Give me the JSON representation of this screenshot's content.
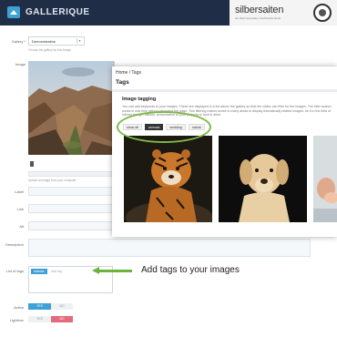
{
  "app": {
    "title": "GALLERIQUE",
    "brand": "silbersaiten",
    "brand_tagline": "die Raumausstatter-Fachhändlerkette"
  },
  "form": {
    "gallery_label": "Gallery",
    "gallery_value": "Demonstration",
    "gallery_hint": "Choose the gallery for this image",
    "image_label": "Image",
    "upload_hint": "Upload an image from your computer",
    "fields": [
      {
        "label": "Label"
      },
      {
        "label": "Link"
      },
      {
        "label": "Alt"
      },
      {
        "label": "Description"
      }
    ],
    "tags_label": "List of tags",
    "tag_chip": "animals",
    "tag_placeholder": "Add tag",
    "active_label": "Active",
    "lightbox_label": "Lightbox",
    "yes": "YES",
    "no": "NO"
  },
  "callout": {
    "text": "Add tags to your images",
    "color": "#6bb33b"
  },
  "panel": {
    "breadcrumb": "Home  /  Tags",
    "title": "Tags",
    "section_title": "Image tagging",
    "description": "You can add keywords to your images. These are displayed in a list above the gallery so that the visitor can filter for the images. The filter search works in real time without reloading the page. This filtering makes sense in many areas to display thematically related images, be it in the field of interior design, fashion, presentation of your projects or food & drink.",
    "filters": [
      {
        "label": "show all",
        "active": false
      },
      {
        "label": "animals",
        "active": true
      },
      {
        "label": "wedding",
        "active": false
      },
      {
        "label": "nature",
        "active": false
      }
    ]
  },
  "colors": {
    "topbar": "#1f2e46",
    "accent": "#3da1d6",
    "yes": "#3da1d6",
    "no": "#e46a7d",
    "highlight": "#7fb845"
  }
}
